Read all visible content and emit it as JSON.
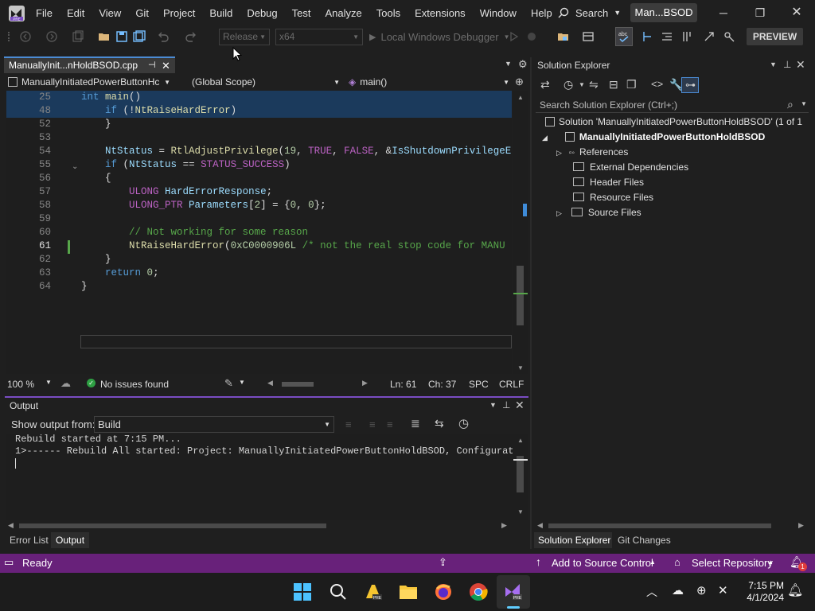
{
  "menu": [
    "File",
    "Edit",
    "View",
    "Git",
    "Project",
    "Build",
    "Debug",
    "Test",
    "Analyze",
    "Tools",
    "Extensions",
    "Window",
    "Help"
  ],
  "search_label": "Search",
  "solution_short": "Man...BSOD",
  "toolbar": {
    "config": "Release",
    "platform": "x64",
    "debugger": "Local Windows Debugger",
    "preview": "PREVIEW"
  },
  "doc_tab": "ManuallyInit...nHoldBSOD.cpp",
  "nav": {
    "project": "ManuallyInitiatedPowerButtonHc",
    "scope": "(Global Scope)",
    "member": "main()"
  },
  "code_lines": [
    {
      "n": "25",
      "tokens": [
        [
          "kw",
          "int "
        ],
        [
          "fn",
          "main"
        ],
        [
          "pl",
          "()"
        ]
      ]
    },
    {
      "n": "48",
      "tokens": [
        [
          "pl",
          "    "
        ],
        [
          "kw",
          "if"
        ],
        [
          "pl",
          " (!"
        ],
        [
          "fn",
          "NtRaiseHardError"
        ],
        [
          "pl",
          ")"
        ]
      ]
    },
    {
      "n": "52",
      "tokens": [
        [
          "pl",
          "    }"
        ]
      ]
    },
    {
      "n": "53",
      "tokens": []
    },
    {
      "n": "54",
      "tokens": [
        [
          "pl",
          "    "
        ],
        [
          "vr",
          "NtStatus"
        ],
        [
          "pl",
          " = "
        ],
        [
          "fn",
          "RtlAdjustPrivilege"
        ],
        [
          "pl",
          "("
        ],
        [
          "nm",
          "19"
        ],
        [
          "pl",
          ", "
        ],
        [
          "mc",
          "TRUE"
        ],
        [
          "pl",
          ", "
        ],
        [
          "mc",
          "FALSE"
        ],
        [
          "pl",
          ", &"
        ],
        [
          "vr",
          "IsShutdownPrivilegeE"
        ]
      ]
    },
    {
      "n": "55",
      "tokens": [
        [
          "pl",
          "    "
        ],
        [
          "kw",
          "if"
        ],
        [
          "pl",
          " ("
        ],
        [
          "vr",
          "NtStatus"
        ],
        [
          "pl",
          " == "
        ],
        [
          "mc",
          "STATUS_SUCCESS"
        ],
        [
          "pl",
          ")"
        ]
      ]
    },
    {
      "n": "56",
      "tokens": [
        [
          "pl",
          "    {"
        ]
      ]
    },
    {
      "n": "57",
      "tokens": [
        [
          "pl",
          "        "
        ],
        [
          "mc",
          "ULONG"
        ],
        [
          "pl",
          " "
        ],
        [
          "vr",
          "HardErrorResponse"
        ],
        [
          "pl",
          ";"
        ]
      ]
    },
    {
      "n": "58",
      "tokens": [
        [
          "pl",
          "        "
        ],
        [
          "mc",
          "ULONG_PTR"
        ],
        [
          "pl",
          " "
        ],
        [
          "vr",
          "Parameters"
        ],
        [
          "pl",
          "["
        ],
        [
          "nm",
          "2"
        ],
        [
          "pl",
          "] = {"
        ],
        [
          "nm",
          "0"
        ],
        [
          "pl",
          ", "
        ],
        [
          "nm",
          "0"
        ],
        [
          "pl",
          "};"
        ]
      ]
    },
    {
      "n": "59",
      "tokens": []
    },
    {
      "n": "60",
      "tokens": [
        [
          "pl",
          "        "
        ],
        [
          "cm",
          "// Not working for some reason"
        ]
      ]
    },
    {
      "n": "61",
      "tokens": [
        [
          "pl",
          "        "
        ],
        [
          "fn",
          "NtRaiseHardError"
        ],
        [
          "pl",
          "("
        ],
        [
          "nm",
          "0xC0000906L"
        ],
        [
          "pl",
          " "
        ],
        [
          "cm",
          "/* not the real stop code for MANU"
        ]
      ]
    },
    {
      "n": "62",
      "tokens": [
        [
          "pl",
          "    }"
        ]
      ]
    },
    {
      "n": "63",
      "tokens": [
        [
          "pl",
          "    "
        ],
        [
          "kw",
          "return"
        ],
        [
          "pl",
          " "
        ],
        [
          "nm",
          "0"
        ],
        [
          "pl",
          ";"
        ]
      ]
    },
    {
      "n": "64",
      "tokens": [
        [
          "pl",
          "}"
        ]
      ]
    }
  ],
  "editor_status": {
    "zoom": "100 %",
    "issues": "No issues found",
    "line": "Ln: 61",
    "col": "Ch: 37",
    "whitespace": "SPC",
    "eol": "CRLF"
  },
  "output": {
    "title": "Output",
    "show_from_label": "Show output from:",
    "source": "Build",
    "lines": [
      "Rebuild started at 7:15 PM...",
      "1>------ Rebuild All started: Project: ManuallyInitiatedPowerButtonHoldBSOD, Configuration"
    ]
  },
  "bottom_tabs": [
    "Error List",
    "Output"
  ],
  "solution_explorer": {
    "title": "Solution Explorer",
    "search_placeholder": "Search Solution Explorer (Ctrl+;)",
    "solution_line": "Solution 'ManuallyInitiatedPowerButtonHoldBSOD' (1 of 1",
    "project": "ManuallyInitiatedPowerButtonHoldBSOD",
    "items": [
      "References",
      "External Dependencies",
      "Header Files",
      "Resource Files",
      "Source Files"
    ],
    "tabs": [
      "Solution Explorer",
      "Git Changes"
    ]
  },
  "statusbar": {
    "ready": "Ready",
    "source_control": "Add to Source Control",
    "repository": "Select Repository",
    "notif_count": "1"
  },
  "clock": {
    "time": "7:15 PM",
    "date": "4/1/2024"
  },
  "colors": {
    "accent": "#68217a",
    "tab_underline": "#4b8bd4",
    "output_border": "#7a4cc3"
  }
}
